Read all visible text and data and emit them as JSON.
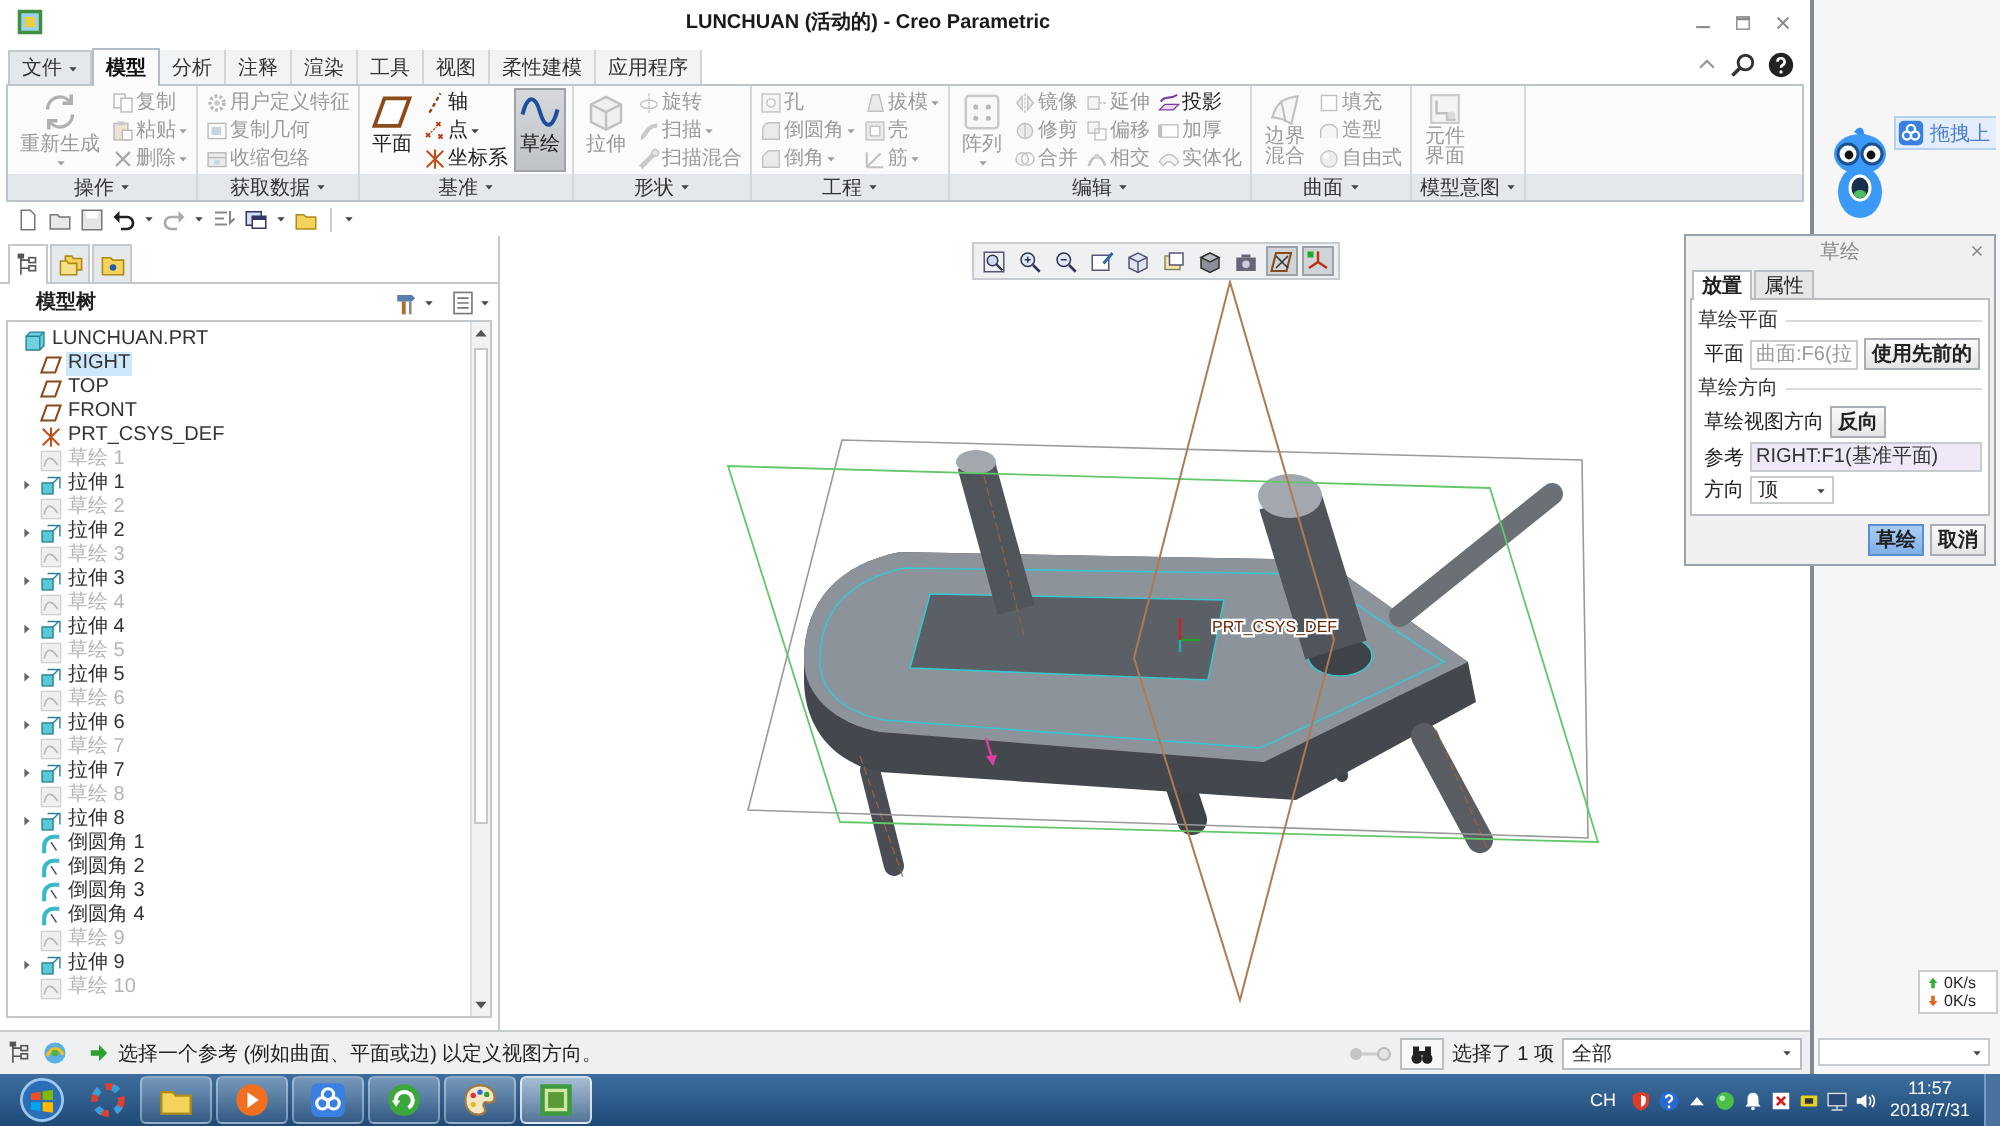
{
  "window": {
    "title": "LUNCHUAN (活动的) - Creo Parametric"
  },
  "ribbon_tabs": [
    {
      "label": "文件",
      "kind": "menu",
      "selected": false
    },
    {
      "label": "模型",
      "kind": "tab",
      "selected": true
    },
    {
      "label": "分析",
      "kind": "tab",
      "selected": false
    },
    {
      "label": "注释",
      "kind": "tab",
      "selected": false
    },
    {
      "label": "渲染",
      "kind": "tab",
      "selected": false
    },
    {
      "label": "工具",
      "kind": "tab",
      "selected": false
    },
    {
      "label": "视图",
      "kind": "tab",
      "selected": false
    },
    {
      "label": "柔性建模",
      "kind": "tab",
      "selected": false
    },
    {
      "label": "应用程序",
      "kind": "tab",
      "selected": false
    }
  ],
  "ribbon_groups": [
    {
      "label": "操作",
      "commands": [
        {
          "label": "重新生成",
          "kind": "large-menu",
          "disabled": true,
          "pressed": false
        },
        {
          "label": "复制",
          "kind": "small",
          "disabled": true,
          "pressed": false
        },
        {
          "label": "粘贴",
          "kind": "small-menu",
          "disabled": true,
          "pressed": false
        },
        {
          "label": "删除",
          "kind": "small-menu",
          "disabled": true,
          "pressed": false
        }
      ]
    },
    {
      "label": "获取数据",
      "commands": [
        {
          "label": "用户定义特征",
          "kind": "small",
          "disabled": true,
          "pressed": false
        },
        {
          "label": "复制几何",
          "kind": "small",
          "disabled": true,
          "pressed": false
        },
        {
          "label": "收缩包络",
          "kind": "small",
          "disabled": true,
          "pressed": false
        }
      ]
    },
    {
      "label": "基准",
      "commands": [
        {
          "label": "平面",
          "kind": "large",
          "disabled": false,
          "pressed": false
        },
        {
          "label": "轴",
          "kind": "small",
          "disabled": false,
          "pressed": false
        },
        {
          "label": "点",
          "kind": "small-menu",
          "disabled": false,
          "pressed": false
        },
        {
          "label": "坐标系",
          "kind": "small",
          "disabled": false,
          "pressed": false
        },
        {
          "label": "草绘",
          "kind": "large",
          "disabled": false,
          "pressed": true
        }
      ]
    },
    {
      "label": "形状",
      "commands": [
        {
          "label": "拉伸",
          "kind": "large",
          "disabled": true,
          "pressed": false
        },
        {
          "label": "旋转",
          "kind": "small",
          "disabled": true,
          "pressed": false
        },
        {
          "label": "扫描",
          "kind": "small-menu",
          "disabled": true,
          "pressed": false
        },
        {
          "label": "扫描混合",
          "kind": "small",
          "disabled": true,
          "pressed": false
        }
      ]
    },
    {
      "label": "工程",
      "commands": [
        {
          "label": "孔",
          "kind": "small",
          "disabled": true,
          "pressed": false
        },
        {
          "label": "倒圆角",
          "kind": "small-menu",
          "disabled": true,
          "pressed": false
        },
        {
          "label": "倒角",
          "kind": "small-menu",
          "disabled": true,
          "pressed": false
        },
        {
          "label": "拔模",
          "kind": "small-menu",
          "disabled": true,
          "pressed": false
        },
        {
          "label": "壳",
          "kind": "small",
          "disabled": true,
          "pressed": false
        },
        {
          "label": "筋",
          "kind": "small-menu",
          "disabled": true,
          "pressed": false
        }
      ]
    },
    {
      "label": "编辑",
      "commands": [
        {
          "label": "阵列",
          "kind": "large-menu",
          "disabled": true,
          "pressed": false
        },
        {
          "label": "镜像",
          "kind": "small",
          "disabled": true,
          "pressed": false
        },
        {
          "label": "修剪",
          "kind": "small",
          "disabled": true,
          "pressed": false
        },
        {
          "label": "合并",
          "kind": "small",
          "disabled": true,
          "pressed": false
        },
        {
          "label": "延伸",
          "kind": "small",
          "disabled": true,
          "pressed": false
        },
        {
          "label": "偏移",
          "kind": "small",
          "disabled": true,
          "pressed": false
        },
        {
          "label": "相交",
          "kind": "small",
          "disabled": true,
          "pressed": false
        },
        {
          "label": "投影",
          "kind": "small",
          "disabled": false,
          "pressed": false
        },
        {
          "label": "加厚",
          "kind": "small",
          "disabled": true,
          "pressed": false
        },
        {
          "label": "实体化",
          "kind": "small",
          "disabled": true,
          "pressed": false
        }
      ]
    },
    {
      "label": "曲面",
      "commands": [
        {
          "label": "边界混合",
          "kind": "large-narrow",
          "disabled": true,
          "pressed": false
        },
        {
          "label": "填充",
          "kind": "small",
          "disabled": true,
          "pressed": false
        },
        {
          "label": "造型",
          "kind": "small",
          "disabled": true,
          "pressed": false
        },
        {
          "label": "自由式",
          "kind": "small",
          "disabled": true,
          "pressed": false
        }
      ]
    },
    {
      "label": "模型意图",
      "commands": [
        {
          "label": "元件界面",
          "kind": "large-narrow",
          "disabled": true,
          "pressed": false
        }
      ]
    }
  ],
  "navigator_tabs": [
    {
      "selected": true
    },
    {
      "selected": false
    },
    {
      "selected": false
    }
  ],
  "model_tree": {
    "title": "模型树",
    "root": {
      "label": "LUNCHUAN.PRT",
      "children": [
        {
          "label": "RIGHT",
          "kind": "plane",
          "selected": true,
          "dimmed": false,
          "expandable": false
        },
        {
          "label": "TOP",
          "kind": "plane",
          "selected": false,
          "dimmed": false,
          "expandable": false
        },
        {
          "label": "FRONT",
          "kind": "plane",
          "selected": false,
          "dimmed": false,
          "expandable": false
        },
        {
          "label": "PRT_CSYS_DEF",
          "kind": "csys",
          "selected": false,
          "dimmed": false,
          "expandable": false
        },
        {
          "label": "草绘 1",
          "kind": "sketch",
          "selected": false,
          "dimmed": true,
          "expandable": false
        },
        {
          "label": "拉伸 1",
          "kind": "extrude",
          "selected": false,
          "dimmed": false,
          "expandable": true
        },
        {
          "label": "草绘 2",
          "kind": "sketch",
          "selected": false,
          "dimmed": true,
          "expandable": false
        },
        {
          "label": "拉伸 2",
          "kind": "extrude",
          "selected": false,
          "dimmed": false,
          "expandable": true
        },
        {
          "label": "草绘 3",
          "kind": "sketch",
          "selected": false,
          "dimmed": true,
          "expandable": false
        },
        {
          "label": "拉伸 3",
          "kind": "extrude",
          "selected": false,
          "dimmed": false,
          "expandable": true
        },
        {
          "label": "草绘 4",
          "kind": "sketch",
          "selected": false,
          "dimmed": true,
          "expandable": false
        },
        {
          "label": "拉伸 4",
          "kind": "extrude",
          "selected": false,
          "dimmed": false,
          "expandable": true
        },
        {
          "label": "草绘 5",
          "kind": "sketch",
          "selected": false,
          "dimmed": true,
          "expandable": false
        },
        {
          "label": "拉伸 5",
          "kind": "extrude",
          "selected": false,
          "dimmed": false,
          "expandable": true
        },
        {
          "label": "草绘 6",
          "kind": "sketch",
          "selected": false,
          "dimmed": true,
          "expandable": false
        },
        {
          "label": "拉伸 6",
          "kind": "extrude",
          "selected": false,
          "dimmed": false,
          "expandable": true
        },
        {
          "label": "草绘 7",
          "kind": "sketch",
          "selected": false,
          "dimmed": true,
          "expandable": false
        },
        {
          "label": "拉伸 7",
          "kind": "extrude",
          "selected": false,
          "dimmed": false,
          "expandable": true
        },
        {
          "label": "草绘 8",
          "kind": "sketch",
          "selected": false,
          "dimmed": true,
          "expandable": false
        },
        {
          "label": "拉伸 8",
          "kind": "extrude",
          "selected": false,
          "dimmed": false,
          "expandable": true
        },
        {
          "label": "倒圆角 1",
          "kind": "round",
          "selected": false,
          "dimmed": false,
          "expandable": false
        },
        {
          "label": "倒圆角 2",
          "kind": "round",
          "selected": false,
          "dimmed": false,
          "expandable": false
        },
        {
          "label": "倒圆角 3",
          "kind": "round",
          "selected": false,
          "dimmed": false,
          "expandable": false
        },
        {
          "label": "倒圆角 4",
          "kind": "round",
          "selected": false,
          "dimmed": false,
          "expandable": false
        },
        {
          "label": "草绘 9",
          "kind": "sketch",
          "selected": false,
          "dimmed": true,
          "expandable": false
        },
        {
          "label": "拉伸 9",
          "kind": "extrude",
          "selected": false,
          "dimmed": false,
          "expandable": true
        },
        {
          "label": "草绘 10",
          "kind": "sketch",
          "selected": false,
          "dimmed": true,
          "expandable": false
        }
      ]
    }
  },
  "view_toolbar": [
    {
      "pressed": false
    },
    {
      "pressed": false
    },
    {
      "pressed": false
    },
    {
      "pressed": false
    },
    {
      "pressed": false
    },
    {
      "pressed": false
    },
    {
      "pressed": false
    },
    {
      "pressed": false
    },
    {
      "pressed": true
    },
    {
      "pressed": true
    }
  ],
  "graphics": {
    "csys_label": "PRT_CSYS_DEF"
  },
  "status_bar": {
    "message": "选择一个参考 (例如曲面、平面或边) 以定义视图方向。",
    "selection": "选择了 1 项",
    "filter": "全部"
  },
  "sketch_dialog": {
    "title": "草绘",
    "tabs": [
      {
        "label": "放置",
        "selected": true
      },
      {
        "label": "属性",
        "selected": false
      }
    ],
    "plane_heading": "草绘平面",
    "plane_label": "平面",
    "plane_value": "曲面:F6(拉",
    "use_previous_button": "使用先前的",
    "orientation_heading": "草绘方向",
    "view_direction_label": "草绘视图方向",
    "flip_button": "反向",
    "reference_label": "参考",
    "reference_value": "RIGHT:F1(基准平面)",
    "direction_label": "方向",
    "direction_value": "顶",
    "buttons": [
      {
        "label": "草绘",
        "kind": "primary"
      },
      {
        "label": "取消",
        "kind": "normal"
      }
    ]
  },
  "desktop": {
    "upload_button": "拖拽上",
    "speed_up": "0K/s",
    "speed_down": "0K/s"
  },
  "taskbar": {
    "apps": [
      {
        "running": false,
        "selected": false
      },
      {
        "running": true,
        "selected": false
      },
      {
        "running": true,
        "selected": false
      },
      {
        "running": true,
        "selected": false
      },
      {
        "running": true,
        "selected": false
      },
      {
        "running": true,
        "selected": false
      },
      {
        "running": true,
        "selected": true
      }
    ],
    "language": "CH",
    "time": "11:57",
    "date": "2018/7/31"
  }
}
